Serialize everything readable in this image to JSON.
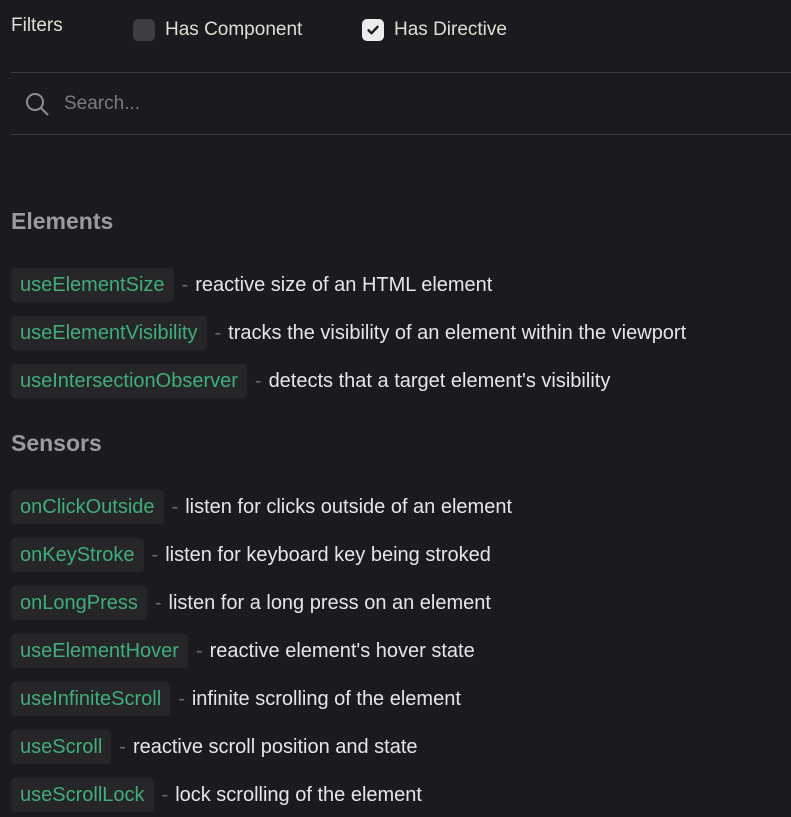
{
  "filters": {
    "title": "Filters",
    "has_component": {
      "label": "Has Component",
      "checked": false
    },
    "has_directive": {
      "label": "Has Directive",
      "checked": true
    }
  },
  "search": {
    "placeholder": "Search...",
    "value": ""
  },
  "sections": [
    {
      "title": "Elements",
      "items": [
        {
          "name": "useElementSize",
          "separator": "-",
          "description": "reactive size of an HTML element"
        },
        {
          "name": "useElementVisibility",
          "separator": "-",
          "description": "tracks the visibility of an element within the viewport"
        },
        {
          "name": "useIntersectionObserver",
          "separator": "-",
          "description": "detects that a target element's visibility"
        }
      ]
    },
    {
      "title": "Sensors",
      "items": [
        {
          "name": "onClickOutside",
          "separator": "-",
          "description": "listen for clicks outside of an element"
        },
        {
          "name": "onKeyStroke",
          "separator": "-",
          "description": "listen for keyboard key being stroked"
        },
        {
          "name": "onLongPress",
          "separator": "-",
          "description": "listen for a long press on an element"
        },
        {
          "name": "useElementHover",
          "separator": "-",
          "description": "reactive element's hover state"
        },
        {
          "name": "useInfiniteScroll",
          "separator": "-",
          "description": "infinite scrolling of the element"
        },
        {
          "name": "useScroll",
          "separator": "-",
          "description": "reactive scroll position and state"
        },
        {
          "name": "useScrollLock",
          "separator": "-",
          "description": "lock scrolling of the element"
        }
      ]
    }
  ],
  "colors": {
    "background": "#1b1b1f",
    "function_name": "#3fae7a",
    "function_bg": "#262628",
    "section_title": "#9a9a9f",
    "checkbox_off": "#3d3d43",
    "checkbox_on": "#ececec"
  },
  "icons": {
    "search": "search-icon",
    "check": "check-icon"
  }
}
